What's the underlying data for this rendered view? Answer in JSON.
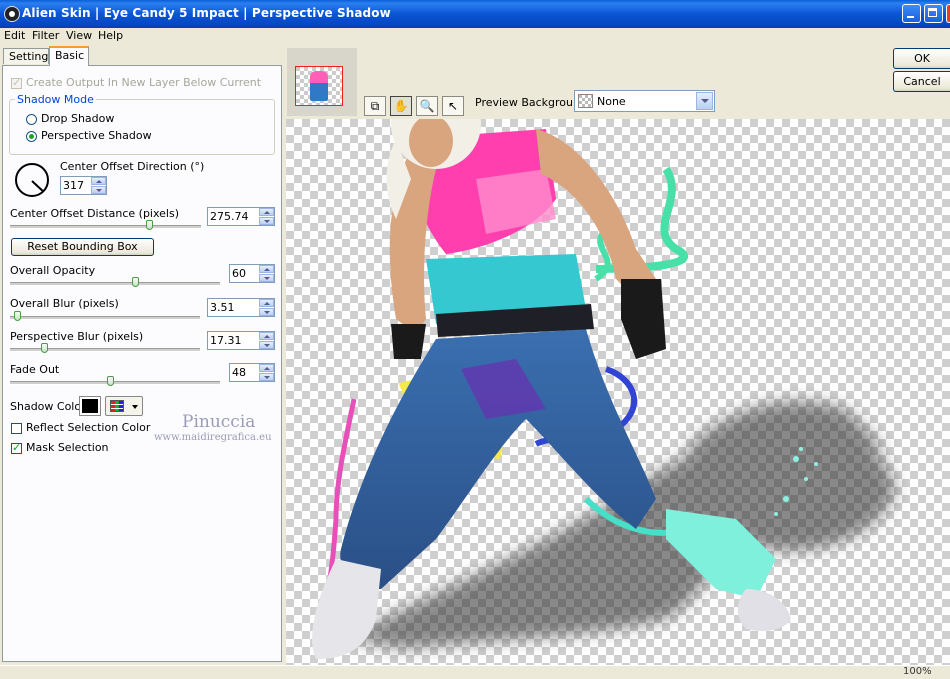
{
  "window": {
    "title": "Alien Skin | Eye Candy 5 Impact | Perspective Shadow"
  },
  "menu": {
    "edit": "Edit",
    "filter": "Filter",
    "view": "View",
    "help": "Help"
  },
  "tabs": {
    "settings": "Settings",
    "basic": "Basic"
  },
  "basic": {
    "create_output_label": "Create Output In New Layer Below Current",
    "create_output_checked": true,
    "shadow_mode_label": "Shadow Mode",
    "drop_shadow_label": "Drop Shadow",
    "perspective_shadow_label": "Perspective Shadow",
    "selected_mode": "Perspective Shadow",
    "center_offset_direction_label": "Center Offset Direction (°)",
    "center_offset_direction_value": "317",
    "center_offset_distance_label": "Center Offset Distance (pixels)",
    "center_offset_distance_value": "275.74",
    "center_offset_distance_level": 0.74,
    "reset_bounding_box_label": "Reset Bounding Box",
    "overall_opacity_label": "Overall Opacity",
    "overall_opacity_value": "60",
    "overall_opacity_level": 0.6,
    "overall_blur_label": "Overall Blur (pixels)",
    "overall_blur_value": "3.51",
    "overall_blur_level": 0.02,
    "perspective_blur_label": "Perspective Blur (pixels)",
    "perspective_blur_value": "17.31",
    "perspective_blur_level": 0.17,
    "fade_out_label": "Fade Out",
    "fade_out_value": "48",
    "fade_out_level": 0.48,
    "shadow_color_label": "Shadow Color",
    "shadow_color": "#000000",
    "reflect_selection_color_label": "Reflect Selection Color",
    "reflect_selection_color_checked": false,
    "mask_selection_label": "Mask Selection",
    "mask_selection_checked": true
  },
  "preview": {
    "background_label": "Preview Background:",
    "background_value": "None",
    "watermark_name": "Pinuccia",
    "watermark_url": "www.maidiregrafica.eu"
  },
  "buttons": {
    "ok": "OK",
    "cancel": "Cancel"
  },
  "status": {
    "zoom": "100%"
  }
}
